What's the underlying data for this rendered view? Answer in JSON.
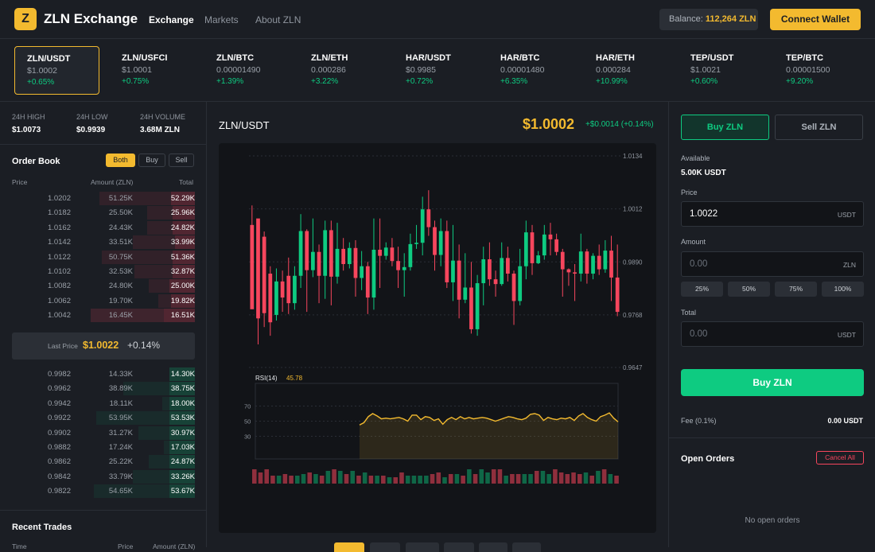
{
  "header": {
    "logo_letter": "Z",
    "brand": "ZLN Exchange",
    "nav": [
      "Exchange",
      "Markets",
      "About ZLN"
    ],
    "balance_label": "Balance:",
    "balance_value": "112,264 ZLN",
    "connect_label": "Connect Wallet"
  },
  "ticker": [
    {
      "pair": "ZLN/USDT",
      "price": "$1.0002",
      "change": "+0.65%"
    },
    {
      "pair": "ZLN/USFCI",
      "price": "$1.0001",
      "change": "+0.75%"
    },
    {
      "pair": "ZLN/BTC",
      "price": "0.00001490",
      "change": "+1.39%"
    },
    {
      "pair": "ZLN/ETH",
      "price": "0.000286",
      "change": "+3.22%"
    },
    {
      "pair": "HAR/USDT",
      "price": "$0.9985",
      "change": "+0.72%"
    },
    {
      "pair": "HAR/BTC",
      "price": "0.00001480",
      "change": "+6.35%"
    },
    {
      "pair": "HAR/ETH",
      "price": "0.000284",
      "change": "+10.99%"
    },
    {
      "pair": "TEP/USDT",
      "price": "$1.0021",
      "change": "+0.60%"
    },
    {
      "pair": "TEP/BTC",
      "price": "0.00001500",
      "change": "+9.20%"
    }
  ],
  "stats": [
    {
      "label": "24H HIGH",
      "value": "$1.0073"
    },
    {
      "label": "24H LOW",
      "value": "$0.9939"
    },
    {
      "label": "24H VOLUME",
      "value": "3.68M ZLN"
    }
  ],
  "orderbook": {
    "title": "Order Book",
    "tabs": [
      "Both",
      "Buy",
      "Sell"
    ],
    "headers": [
      "Price",
      "Amount (ZLN)",
      "Total"
    ],
    "asks": [
      {
        "price": "1.0202",
        "amount": "51.25K",
        "total": "52.29K",
        "amt_depth": 0.52,
        "tot_depth": 0.13
      },
      {
        "price": "1.0182",
        "amount": "25.50K",
        "total": "25.96K",
        "amt_depth": 0.26,
        "tot_depth": 0.12
      },
      {
        "price": "1.0162",
        "amount": "24.43K",
        "total": "24.82K",
        "amt_depth": 0.26,
        "tot_depth": 0.12
      },
      {
        "price": "1.0142",
        "amount": "33.51K",
        "total": "33.99K",
        "amt_depth": 0.34,
        "tot_depth": 0.11
      },
      {
        "price": "1.0122",
        "amount": "50.75K",
        "total": "51.36K",
        "amt_depth": 0.51,
        "tot_depth": 0.12
      },
      {
        "price": "1.0102",
        "amount": "32.53K",
        "total": "32.87K",
        "amt_depth": 0.33,
        "tot_depth": 0.12
      },
      {
        "price": "1.0082",
        "amount": "24.80K",
        "total": "25.00K",
        "amt_depth": 0.25,
        "tot_depth": 0.14
      },
      {
        "price": "1.0062",
        "amount": "19.70K",
        "total": "19.82K",
        "amt_depth": 0.2,
        "tot_depth": 0.13
      },
      {
        "price": "1.0042",
        "amount": "16.45K",
        "total": "16.51K",
        "amt_depth": 0.17,
        "tot_depth": 0.57
      }
    ],
    "last_label": "Last Price",
    "last_price": "$1.0022",
    "last_change": "+0.14%",
    "bids": [
      {
        "price": "0.9982",
        "amount": "14.33K",
        "total": "14.30K",
        "amt_depth": 0.14,
        "tot_depth": 0.14
      },
      {
        "price": "0.9962",
        "amount": "38.89K",
        "total": "38.75K",
        "amt_depth": 0.39,
        "tot_depth": 0.14
      },
      {
        "price": "0.9942",
        "amount": "18.11K",
        "total": "18.00K",
        "amt_depth": 0.18,
        "tot_depth": 0.14
      },
      {
        "price": "0.9922",
        "amount": "53.95K",
        "total": "53.53K",
        "amt_depth": 0.54,
        "tot_depth": 0.14
      },
      {
        "price": "0.9902",
        "amount": "31.27K",
        "total": "30.97K",
        "amt_depth": 0.31,
        "tot_depth": 0.14
      },
      {
        "price": "0.9882",
        "amount": "17.24K",
        "total": "17.03K",
        "amt_depth": 0.17,
        "tot_depth": 0.14
      },
      {
        "price": "0.9862",
        "amount": "25.22K",
        "total": "24.87K",
        "amt_depth": 0.25,
        "tot_depth": 0.14
      },
      {
        "price": "0.9842",
        "amount": "33.79K",
        "total": "33.26K",
        "amt_depth": 0.34,
        "tot_depth": 0.14
      },
      {
        "price": "0.9822",
        "amount": "54.65K",
        "total": "53.67K",
        "amt_depth": 0.55,
        "tot_depth": 0.14
      }
    ]
  },
  "recent_trades": {
    "title": "Recent Trades",
    "headers": [
      "Time",
      "Price",
      "Amount (ZLN)"
    ]
  },
  "market": {
    "pair": "ZLN/USDT",
    "price": "$1.0002",
    "change": "+$0.0014 (+0.14%)"
  },
  "chart_data": {
    "type": "candlestick",
    "y_ticks": [
      "1.0134",
      "1.0012",
      "0.9890",
      "0.9768",
      "0.9647"
    ],
    "ylim": [
      0.9647,
      1.0134
    ],
    "candles": [
      [
        0.9781,
        0.9975,
        0.9795,
        1.002,
        "down"
      ],
      [
        0.976,
        0.999,
        0.97,
        0.997,
        "down"
      ],
      [
        0.9772,
        0.9948,
        0.974,
        0.996,
        "down"
      ],
      [
        0.9863,
        0.9751,
        0.972,
        0.988,
        "down"
      ],
      [
        0.9768,
        0.9845,
        0.9755,
        0.9875,
        "up"
      ],
      [
        0.9845,
        0.9808,
        0.9775,
        0.987,
        "down"
      ],
      [
        0.9858,
        0.9795,
        0.977,
        0.99,
        "down"
      ],
      [
        0.9795,
        0.9858,
        0.978,
        0.988,
        "up"
      ],
      [
        0.9858,
        0.9961,
        0.983,
        1.0,
        "up"
      ],
      [
        0.9961,
        0.9871,
        0.9775,
        0.9965,
        "down"
      ],
      [
        0.9871,
        0.9913,
        0.9855,
        0.999,
        "up"
      ],
      [
        0.9913,
        0.9858,
        0.9795,
        0.993,
        "down"
      ],
      [
        0.9858,
        0.9963,
        0.9805,
        0.9985,
        "up"
      ],
      [
        0.9963,
        0.9856,
        0.979,
        0.9985,
        "down"
      ],
      [
        0.9856,
        0.992,
        0.984,
        0.998,
        "up"
      ],
      [
        0.992,
        0.9885,
        0.987,
        0.9945,
        "down"
      ],
      [
        0.9885,
        0.9922,
        0.9875,
        0.9935,
        "up"
      ],
      [
        0.9922,
        0.9853,
        0.981,
        0.994,
        "down"
      ],
      [
        0.9853,
        0.988,
        0.9825,
        0.9915,
        "up"
      ],
      [
        0.988,
        0.9808,
        0.977,
        0.989,
        "down"
      ],
      [
        0.9808,
        0.9918,
        0.978,
        0.999,
        "up"
      ],
      [
        0.9918,
        0.9904,
        0.983,
        0.999,
        "down"
      ],
      [
        0.9904,
        0.9923,
        0.9895,
        0.9935,
        "up"
      ],
      [
        0.9923,
        0.9892,
        0.988,
        0.9945,
        "down"
      ],
      [
        0.9892,
        0.9871,
        0.983,
        0.9925,
        "down"
      ],
      [
        0.9871,
        0.9878,
        0.981,
        0.991,
        "up"
      ],
      [
        0.9878,
        0.9931,
        0.987,
        0.9955,
        "up"
      ],
      [
        0.9931,
        0.9934,
        0.992,
        0.9975,
        "up"
      ],
      [
        0.9934,
        1.0011,
        0.9905,
        1.004,
        "up"
      ],
      [
        1.0011,
        0.997,
        0.995,
        1.0055,
        "down"
      ],
      [
        0.997,
        0.9906,
        0.987,
        0.9985,
        "down"
      ],
      [
        0.9906,
        0.9961,
        0.988,
        0.999,
        "up"
      ],
      [
        0.9961,
        0.9843,
        0.983,
        0.9985,
        "down"
      ],
      [
        0.9843,
        0.9893,
        0.98,
        0.9975,
        "up"
      ],
      [
        0.9893,
        0.9803,
        0.976,
        0.993,
        "down"
      ],
      [
        0.9803,
        0.9831,
        0.9795,
        0.991,
        "up"
      ],
      [
        0.9831,
        0.9735,
        0.9725,
        0.989,
        "down"
      ],
      [
        0.9735,
        0.9841,
        0.972,
        0.986,
        "up"
      ],
      [
        0.9841,
        0.9896,
        0.979,
        0.9925,
        "up"
      ],
      [
        0.9896,
        0.985,
        0.9835,
        0.9935,
        "down"
      ],
      [
        0.985,
        0.9839,
        0.981,
        0.987,
        "down"
      ],
      [
        0.9839,
        0.9899,
        0.9835,
        0.9935,
        "up"
      ],
      [
        0.9899,
        0.9863,
        0.9845,
        0.9925,
        "down"
      ],
      [
        0.9863,
        0.98,
        0.9745,
        0.987,
        "down"
      ],
      [
        0.98,
        0.988,
        0.979,
        0.992,
        "up"
      ],
      [
        0.988,
        0.9958,
        0.985,
        0.9985,
        "up"
      ],
      [
        0.9958,
        0.9887,
        0.986,
        0.9975,
        "down"
      ],
      [
        0.9887,
        0.9905,
        0.9885,
        0.9915,
        "up"
      ],
      [
        0.9905,
        0.9953,
        0.9895,
        0.9975,
        "up"
      ],
      [
        0.9953,
        0.9942,
        0.9905,
        0.998,
        "down"
      ],
      [
        0.9942,
        0.9913,
        0.9905,
        0.9955,
        "down"
      ],
      [
        0.9913,
        0.9873,
        0.981,
        0.992,
        "down"
      ],
      [
        0.9873,
        0.9866,
        0.9835,
        0.9875,
        "down"
      ],
      [
        0.9866,
        0.9863,
        0.98,
        0.9885,
        "down"
      ],
      [
        0.9863,
        0.9914,
        0.9845,
        0.9955,
        "up"
      ],
      [
        0.9914,
        0.9863,
        0.984,
        0.992,
        "down"
      ],
      [
        0.9863,
        0.9904,
        0.985,
        0.991,
        "up"
      ],
      [
        0.9904,
        0.9873,
        0.986,
        0.993,
        "down"
      ],
      [
        0.9873,
        0.9916,
        0.9865,
        0.994,
        "up"
      ],
      [
        0.9916,
        0.9854,
        0.98,
        0.995,
        "down"
      ],
      [
        0.9854,
        0.9775,
        0.9765,
        0.993,
        "down"
      ]
    ],
    "rsi_label": "RSI(14)",
    "rsi_value": "45.78",
    "rsi_ticks": [
      "70",
      "50",
      "30"
    ],
    "rsi_values": [
      45,
      48,
      56,
      60,
      57,
      53,
      54,
      53,
      54,
      55,
      53,
      50,
      58,
      58,
      52,
      56,
      55,
      51,
      53,
      46,
      52,
      55,
      52,
      56,
      53,
      55,
      53,
      54,
      55,
      54,
      52,
      50,
      52,
      54,
      56,
      55,
      53,
      52,
      54,
      59,
      60,
      58,
      51,
      55,
      53,
      52,
      54,
      53,
      55,
      51,
      57,
      60,
      55,
      52,
      50,
      56,
      58,
      61,
      54,
      49
    ],
    "rsi_ylim": [
      0,
      100
    ],
    "volumes": [
      0.9,
      0.7,
      0.9,
      0.5,
      0.5,
      0.6,
      0.5,
      0.5,
      0.6,
      0.7,
      0.6,
      0.5,
      0.8,
      0.9,
      0.8,
      0.6,
      0.8,
      0.5,
      0.7,
      0.5,
      0.5,
      0.5,
      0.4,
      0.4,
      0.7,
      0.5,
      0.5,
      0.5,
      0.5,
      0.6,
      0.7,
      0.4,
      0.6,
      0.6,
      0.5,
      0.9,
      0.6,
      0.9,
      0.7,
      0.9,
      0.9,
      0.5,
      0.6,
      0.6,
      0.6,
      0.6,
      0.8,
      0.8,
      0.6,
      0.9,
      0.7,
      0.6,
      0.7,
      0.6,
      0.7,
      0.5,
      0.8,
      0.9,
      0.6,
      0.5
    ]
  },
  "trade": {
    "buy_tab": "Buy ZLN",
    "sell_tab": "Sell ZLN",
    "available_label": "Available",
    "available_value": "5.00K USDT",
    "price_label": "Price",
    "price_value": "1.0022",
    "price_unit": "USDT",
    "amount_label": "Amount",
    "amount_placeholder": "0.00",
    "amount_unit": "ZLN",
    "pcts": [
      "25%",
      "50%",
      "75%",
      "100%"
    ],
    "total_label": "Total",
    "total_placeholder": "0.00",
    "total_unit": "USDT",
    "submit": "Buy ZLN",
    "fee_label": "Fee (0.1%)",
    "fee_value": "0.00 USDT"
  },
  "open_orders": {
    "title": "Open Orders",
    "cancel_all": "Cancel All",
    "empty": "No open orders"
  },
  "colors": {
    "accent": "#f3ba2f",
    "up": "#0ecb81",
    "down": "#f6465d",
    "bg": "#1b1e24"
  }
}
